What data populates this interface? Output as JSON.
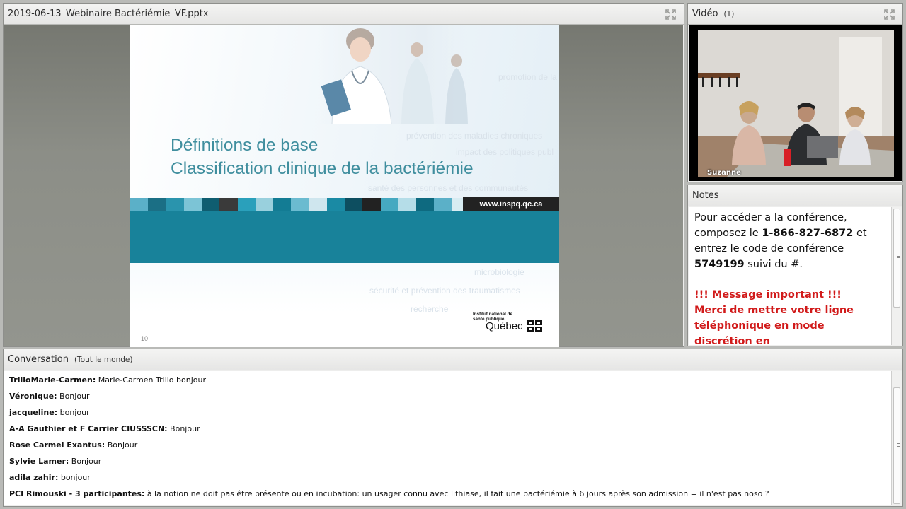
{
  "share": {
    "title": "2019-06-13_Webinaire Bactériémie_VF.pptx",
    "fullscreen_icon": "fullscreen-icon",
    "slide": {
      "title_line1": "Définitions de base",
      "title_line2": "Classification clinique de la bactériémie",
      "url": "www.inspq.qc.ca",
      "number": "10",
      "logo_small": "Institut national de santé publique",
      "logo_big": "Québec",
      "background_words": [
        "promotion de la",
        "impact des politiques publ",
        "prévention des maladies chroniques",
        "santé des personnes et des communautés",
        "microbiologie",
        "sécurité et prévention des traumatismes",
        "recherche"
      ],
      "strip_colors": [
        "#5bb0c8",
        "#1b6f85",
        "#2a94ad",
        "#7cc4d6",
        "#0f5d70",
        "#3a3a3a",
        "#2aa0bb",
        "#99d0dd",
        "#137c94",
        "#6bbbd0",
        "#cfe6ee",
        "#1a8aa4",
        "#0d4e60",
        "#222222",
        "#46a9c1",
        "#b5dde8",
        "#0e6a80",
        "#5bb0c8",
        "#d8ecf2",
        "#1a8aa4",
        "#0b4a5a",
        "#88c8d8",
        "#2aa0bb",
        "#eaf4f8"
      ],
      "accent": "#3f8e9e",
      "band_color": "#18829a"
    }
  },
  "video": {
    "title": "Vidéo",
    "count": "(1)",
    "fullscreen_icon": "fullscreen-icon",
    "participant": "Suzanne"
  },
  "notes": {
    "title": "Notes",
    "p1_a": "Pour accéder a la conférence, composez le ",
    "p1_phone": "1-866-827-6872",
    "p1_b": " et entrez le code de conférence ",
    "p1_code": "5749199",
    "p1_c": " suivi du #.",
    "important": "!!! Message important !!!",
    "important_text": "Merci de mettre votre ligne téléphonique en mode discrétion en"
  },
  "chat": {
    "title": "Conversation",
    "scope": "(Tout le monde)",
    "messages": [
      {
        "who": "TrilloMarie-Carmen:",
        "text": " Marie-Carmen Trillo bonjour"
      },
      {
        "who": "Véronique:",
        "text": " Bonjour"
      },
      {
        "who": "jacqueline:",
        "text": " bonjour"
      },
      {
        "who": "A-A Gauthier et F Carrier CIUSSSCN:",
        "text": " Bonjour"
      },
      {
        "who": "Rose Carmel Exantus:",
        "text": " Bonjour"
      },
      {
        "who": "Sylvie Lamer:",
        "text": " Bonjour"
      },
      {
        "who": "adila zahir:",
        "text": " bonjour"
      },
      {
        "who": "PCI Rimouski - 3 participantes:",
        "text": " à la notion ne doit pas être présente ou en incubation: un usager connu avec lithiase, il fait une bactériémie à 6 jours après son admission = il n'est pas noso ?"
      }
    ]
  }
}
